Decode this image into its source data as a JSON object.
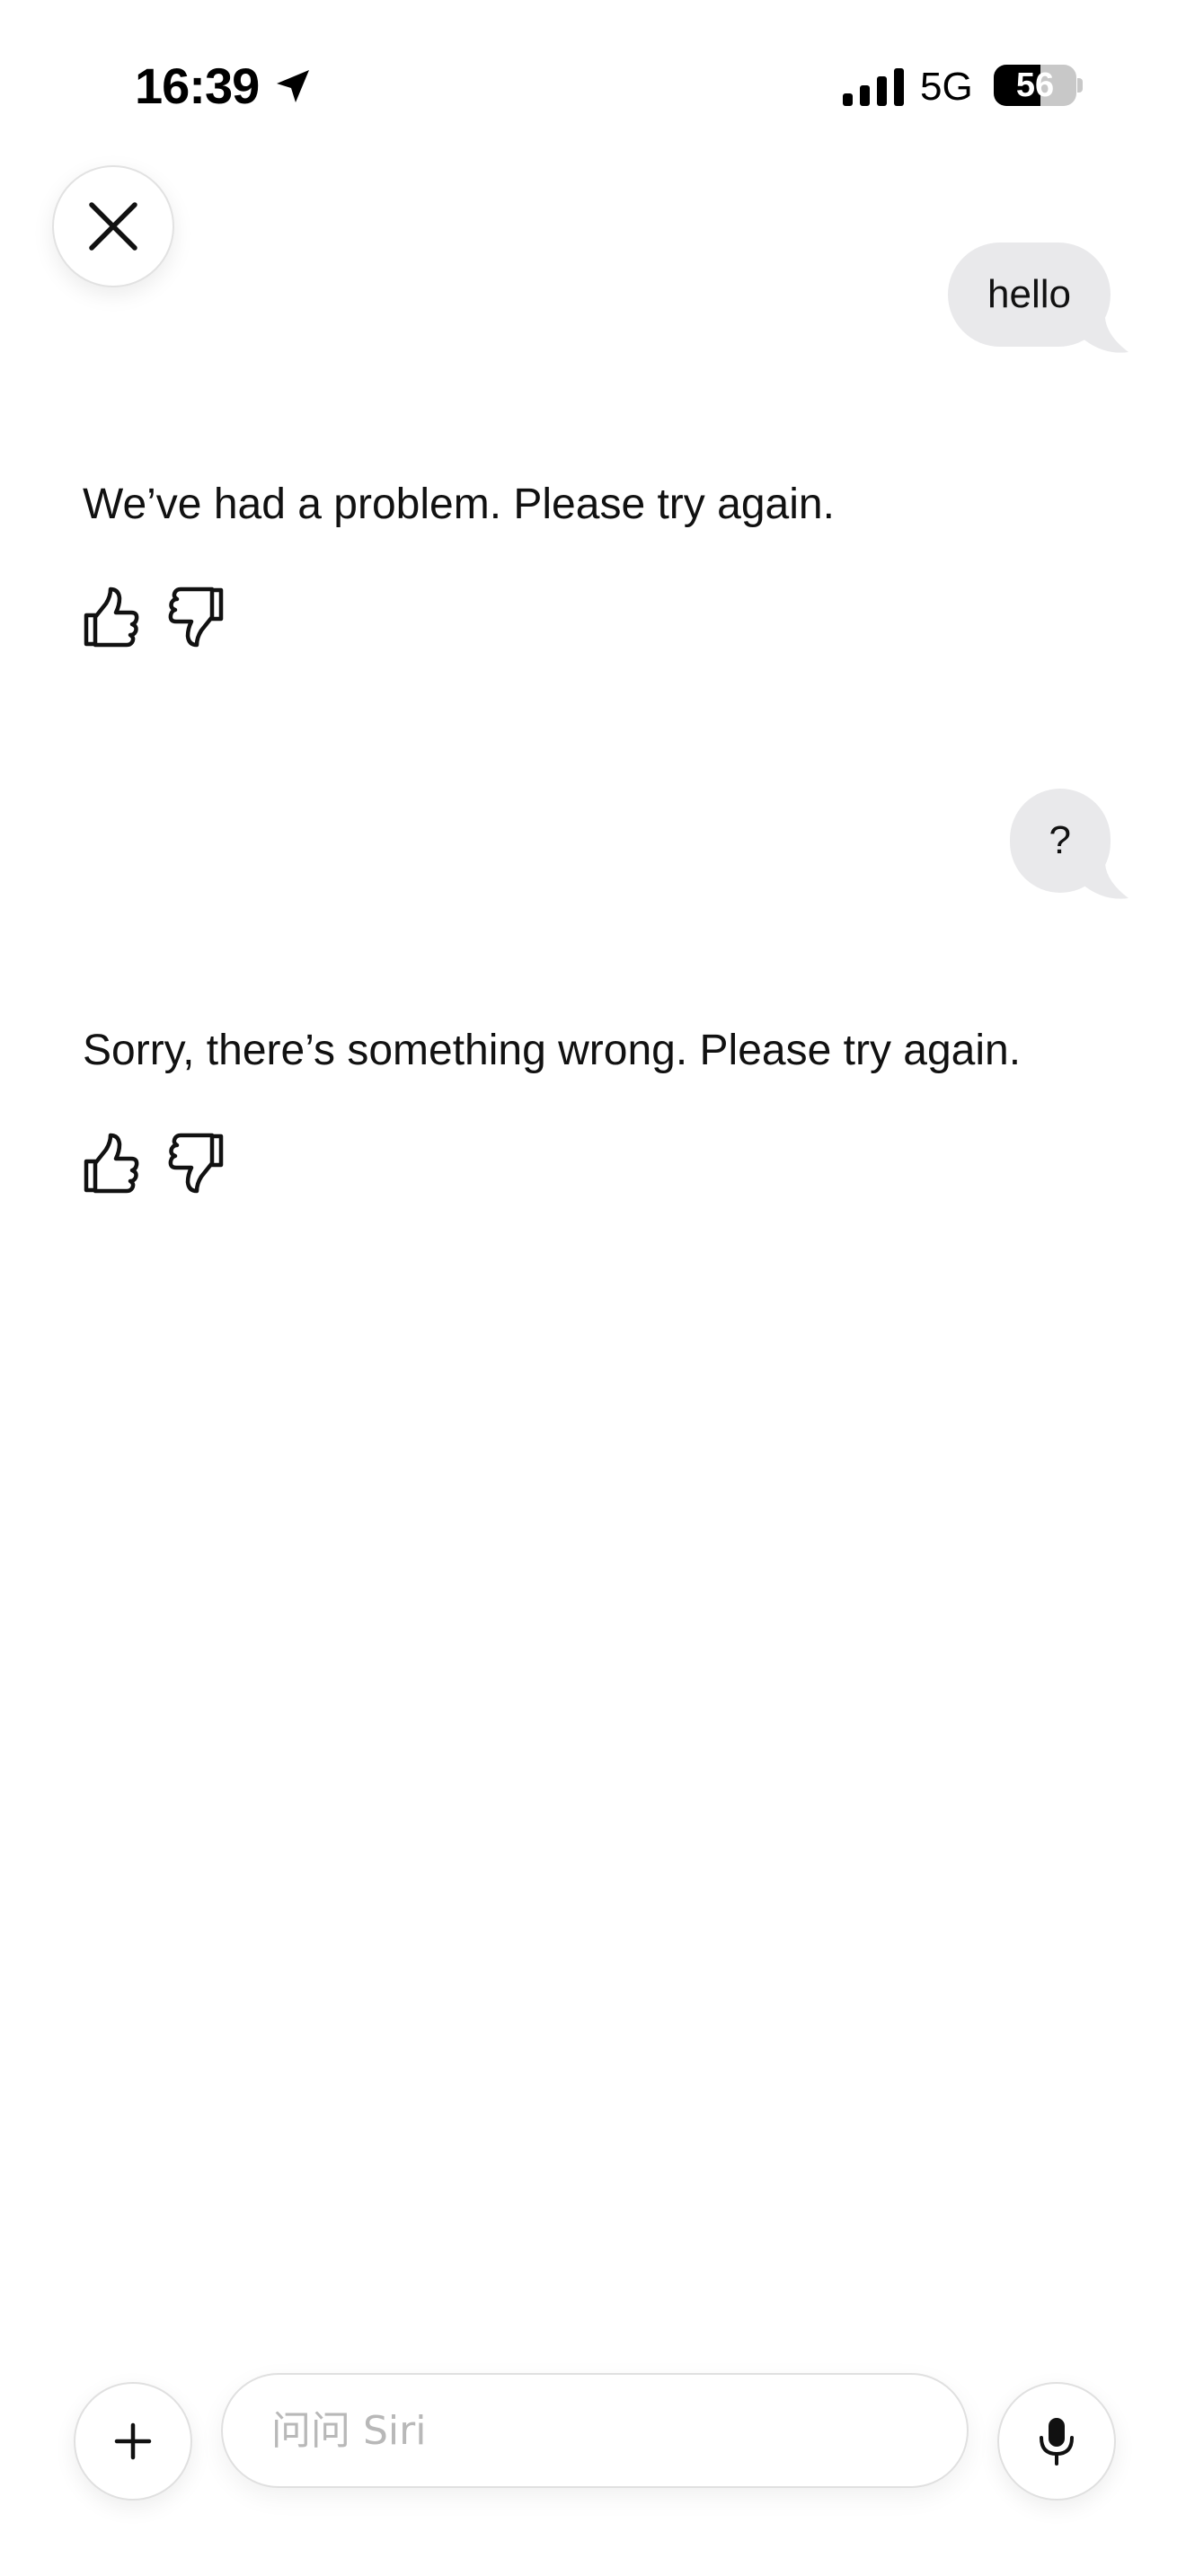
{
  "status_bar": {
    "time": "16:39",
    "network": "5G",
    "battery_level": "56",
    "battery_fraction": 0.56,
    "icons": [
      "location-arrow-icon",
      "cellular-signal-icon",
      "battery-icon"
    ]
  },
  "header": {
    "close_icon": "close-icon"
  },
  "conversation": {
    "messages": [
      {
        "role": "user",
        "text": "hello"
      },
      {
        "role": "assistant",
        "text": "We’ve had a problem. Please try again."
      },
      {
        "role": "user",
        "text": "?"
      },
      {
        "role": "assistant",
        "text": "Sorry, there’s something wrong. Please try again."
      }
    ],
    "feedback_icons": [
      "thumbs-up-icon",
      "thumbs-down-icon"
    ]
  },
  "composer": {
    "placeholder": "问问 Siri",
    "value": "",
    "plus_icon": "plus-icon",
    "mic_icon": "microphone-icon"
  },
  "colors": {
    "user_bubble": "#e9e9eb",
    "text": "#111111",
    "placeholder": "#b8b8b8",
    "border": "#e0e0e0"
  }
}
